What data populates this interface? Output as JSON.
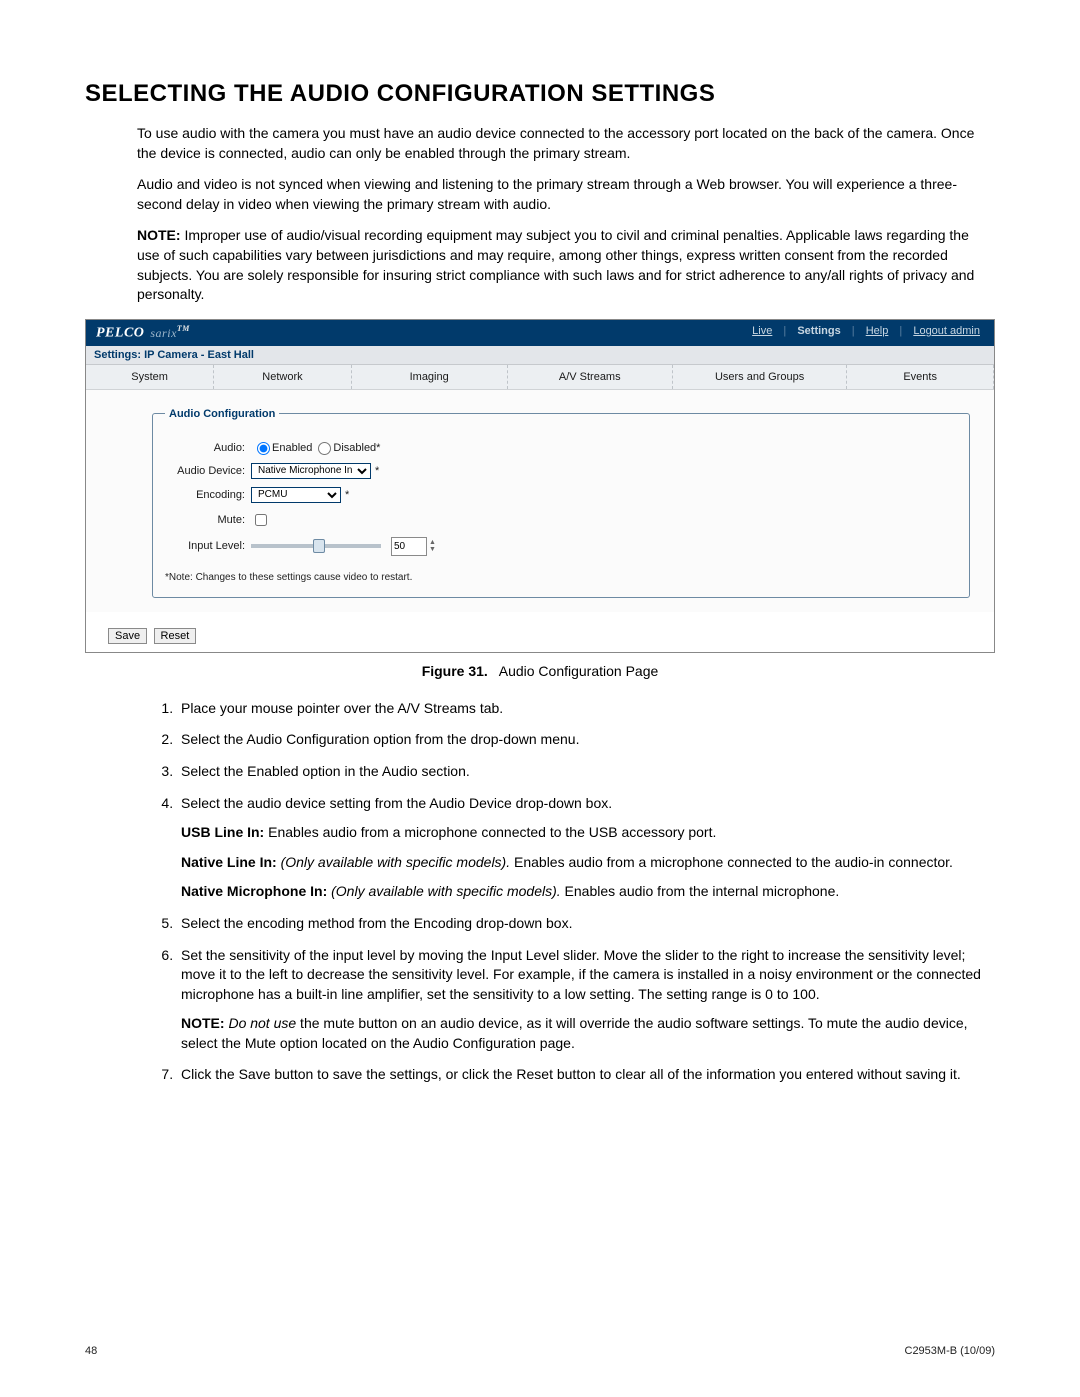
{
  "title": "SELECTING THE AUDIO CONFIGURATION SETTINGS",
  "para1": "To use audio with the camera you must have an audio device connected to the accessory port located on the back of the camera. Once the device is connected, audio can only be enabled through the primary stream.",
  "para2": "Audio and video is not synced when viewing and listening to the primary stream through a Web browser. You will experience a three-second delay in video when viewing the primary stream with audio.",
  "note_label": "NOTE:",
  "para3": "Improper use of audio/visual recording equipment may subject you to civil and criminal penalties. Applicable laws regarding the use of such capabilities vary between jurisdictions and may require, among other things, express written consent from the recorded subjects. You are solely responsible for insuring strict compliance with such laws and for strict adherence to any/all rights of privacy and personalty.",
  "shot": {
    "brand_pelco": "PELCO",
    "brand_sarix": "sarix",
    "tm": "TM",
    "links": {
      "live": "Live",
      "settings": "Settings",
      "help": "Help",
      "logout": "Logout admin"
    },
    "subheader": "Settings: IP Camera - East Hall",
    "menu": [
      "System",
      "Network",
      "Imaging",
      "A/V Streams",
      "Users and Groups",
      "Events"
    ],
    "legend": "Audio Configuration",
    "labels": {
      "audio": "Audio:",
      "enabled": "Enabled",
      "disabled": "Disabled*",
      "audio_device": "Audio Device:",
      "encoding": "Encoding:",
      "mute": "Mute:",
      "input_level": "Input Level:"
    },
    "device_value": "Native Microphone In",
    "encoding_value": "PCMU",
    "input_value": "50",
    "note": "*Note: Changes to these settings cause video to restart.",
    "save": "Save",
    "reset": "Reset"
  },
  "fig_label": "Figure 31.",
  "fig_caption": "Audio Configuration Page",
  "steps": {
    "s1": "Place your mouse pointer over the A/V Streams tab.",
    "s2": "Select the Audio Configuration option from the drop-down menu.",
    "s3": "Select the Enabled option in the Audio section.",
    "s4": "Select the audio device setting from the Audio Device drop-down box.",
    "s4a_label": "USB Line In:",
    "s4a_text": " Enables audio from a microphone connected to the USB accessory port.",
    "s4b_label": "Native Line In:",
    "s4b_em": " (Only available with specific models).",
    "s4b_text": " Enables audio from a microphone connected to the audio-in connector.",
    "s4c_label": "Native Microphone In:",
    "s4c_em": " (Only available with specific models).",
    "s4c_text": " Enables audio from the internal microphone.",
    "s5": "Select the encoding method from the Encoding drop-down box.",
    "s6": "Set the sensitivity of the input level by moving the Input Level slider. Move the slider to the right to increase the sensitivity level; move it to the left to decrease the sensitivity level. For example, if the camera is installed in a noisy environment or the connected microphone has a built-in line amplifier, set the sensitivity to a low setting. The setting range is 0 to 100.",
    "s6_note_label": "NOTE:",
    "s6_note_em": " Do not use",
    "s6_note_text": " the mute button on an audio device, as it will override the audio software settings. To mute the audio device, select the Mute option located on the Audio Configuration page.",
    "s7": "Click the Save button to save the settings, or click the Reset button to clear all of the information you entered without saving it."
  },
  "footer": {
    "page": "48",
    "doc": "C2953M-B (10/09)"
  }
}
